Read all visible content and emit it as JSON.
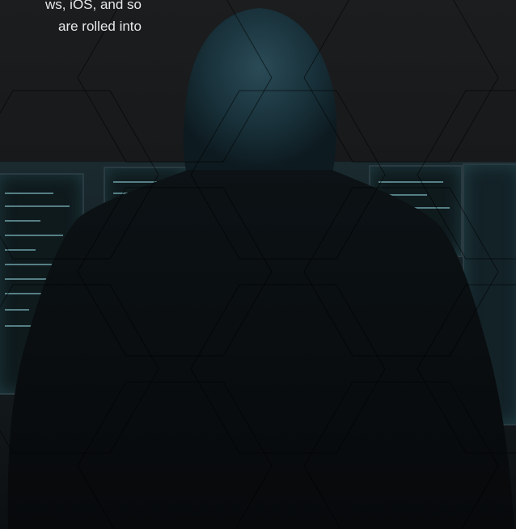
{
  "intro_text": {
    "line1": "ws, iOS, and so",
    "line2": "are rolled into"
  },
  "hero_image": {
    "subject": "hooded person facing computer monitors"
  },
  "colors": {
    "background": "#18191b",
    "text": "#e6e9ea",
    "monitor_glow": "#6da1a8",
    "hood": "#1f3a44"
  }
}
